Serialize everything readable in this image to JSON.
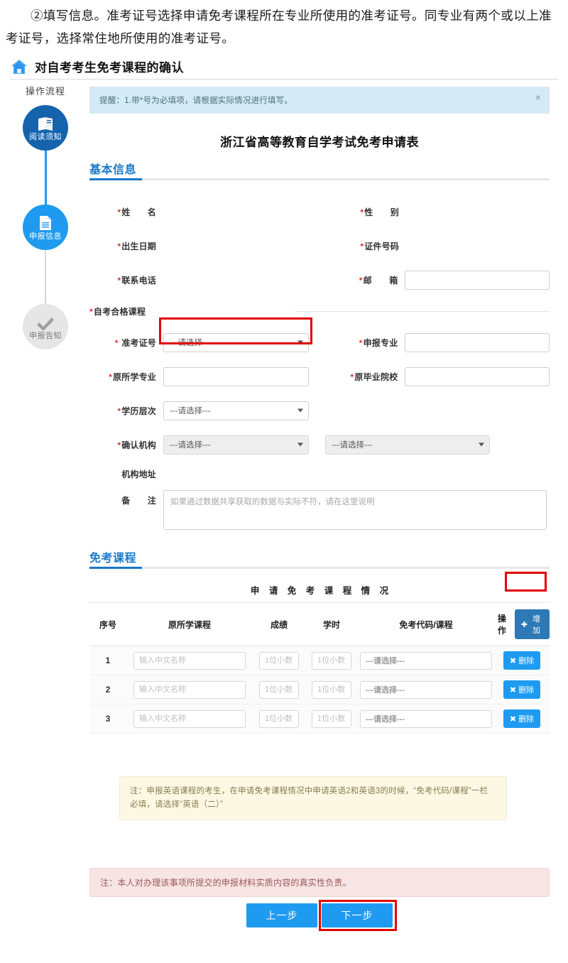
{
  "intro": {
    "text": "②填写信息。准考证号选择申请免考课程所在专业所使用的准考证号。同专业有两个或以上准考证号，选择常住地所使用的准考证号。",
    "bold_lead": "②填写信息。"
  },
  "header": {
    "title": "对自考考生免考课程的确认",
    "icon": "home-icon"
  },
  "flow": {
    "title": "操作流程",
    "steps": [
      {
        "label": "阅读须知",
        "state": "done",
        "icon": "book-icon",
        "color": "#1663ad"
      },
      {
        "label": "申报信息",
        "state": "current",
        "icon": "document-icon",
        "color": "#1e9bf0"
      },
      {
        "label": "申报告知",
        "state": "pending",
        "icon": "check-icon",
        "color": "#e6e6e6"
      }
    ]
  },
  "alert": {
    "text": "提醒：1.带*号为必填项，请根据实际情况进行填写。",
    "close": "×"
  },
  "form": {
    "title": "浙江省高等教育自学考试免考申请表",
    "basic_section": "基本信息",
    "labels": {
      "name": "姓　　名",
      "gender": "性　　别",
      "birthdate": "出生日期",
      "id_number": "证件号码",
      "phone": "联系电话",
      "email": "邮　　箱",
      "qualified_courses": "自考合格课程",
      "exam_ticket": "准考证号",
      "apply_major": "申报专业",
      "original_major": "原所学专业",
      "original_school": "原毕业院校",
      "education_level": "学历层次",
      "confirm_org": "确认机构",
      "org_address": "机构地址",
      "remark": "备　　注"
    },
    "values": {
      "name": "",
      "gender": "",
      "birthdate": "",
      "id_number": "",
      "phone": "",
      "email": "",
      "apply_major": "",
      "original_major": "",
      "original_school": ""
    },
    "select_placeholder": "---请选择---",
    "remark_placeholder": "如果通过数据共享获取的数据与实际不符，请在这里说明"
  },
  "exempt": {
    "section": "免考课程",
    "table_caption": "申 请 免 考 课 程 情 况",
    "columns": [
      "序号",
      "原所学课程",
      "成绩",
      "学时",
      "免考代码/课程",
      "操作"
    ],
    "add_label": "增加",
    "add_icon": "plus-icon",
    "delete_label": "删除",
    "delete_icon": "times-icon",
    "placeholders": {
      "course_name": "输入中文名称",
      "score": "1位小数",
      "hours": "1位小数",
      "code": "---请选择---"
    },
    "rows": [
      {
        "no": "1",
        "course": "",
        "score": "",
        "hours": "",
        "code": ""
      },
      {
        "no": "2",
        "course": "",
        "score": "",
        "hours": "",
        "code": ""
      },
      {
        "no": "3",
        "course": "",
        "score": "",
        "hours": "",
        "code": ""
      }
    ]
  },
  "notes": {
    "yellow": "注：申报英语课程的考生，在申请免考课程情况中申请英语2和英语3的时候，“免考代码/课程”一栏必填，请选择“英语（二）”",
    "pink": "注：本人对办理该事项所提交的申报材料实质内容的真实性负责。"
  },
  "buttons": {
    "prev": "上一步",
    "next": "下一步"
  },
  "colors": {
    "accent_blue": "#1e9bf0",
    "deep_blue": "#1663ad",
    "highlight_red": "#e10000",
    "alert_bg": "#d4eaf5",
    "warn_yellow": "#fcf8e3",
    "warn_pink": "#f7e4e4"
  }
}
